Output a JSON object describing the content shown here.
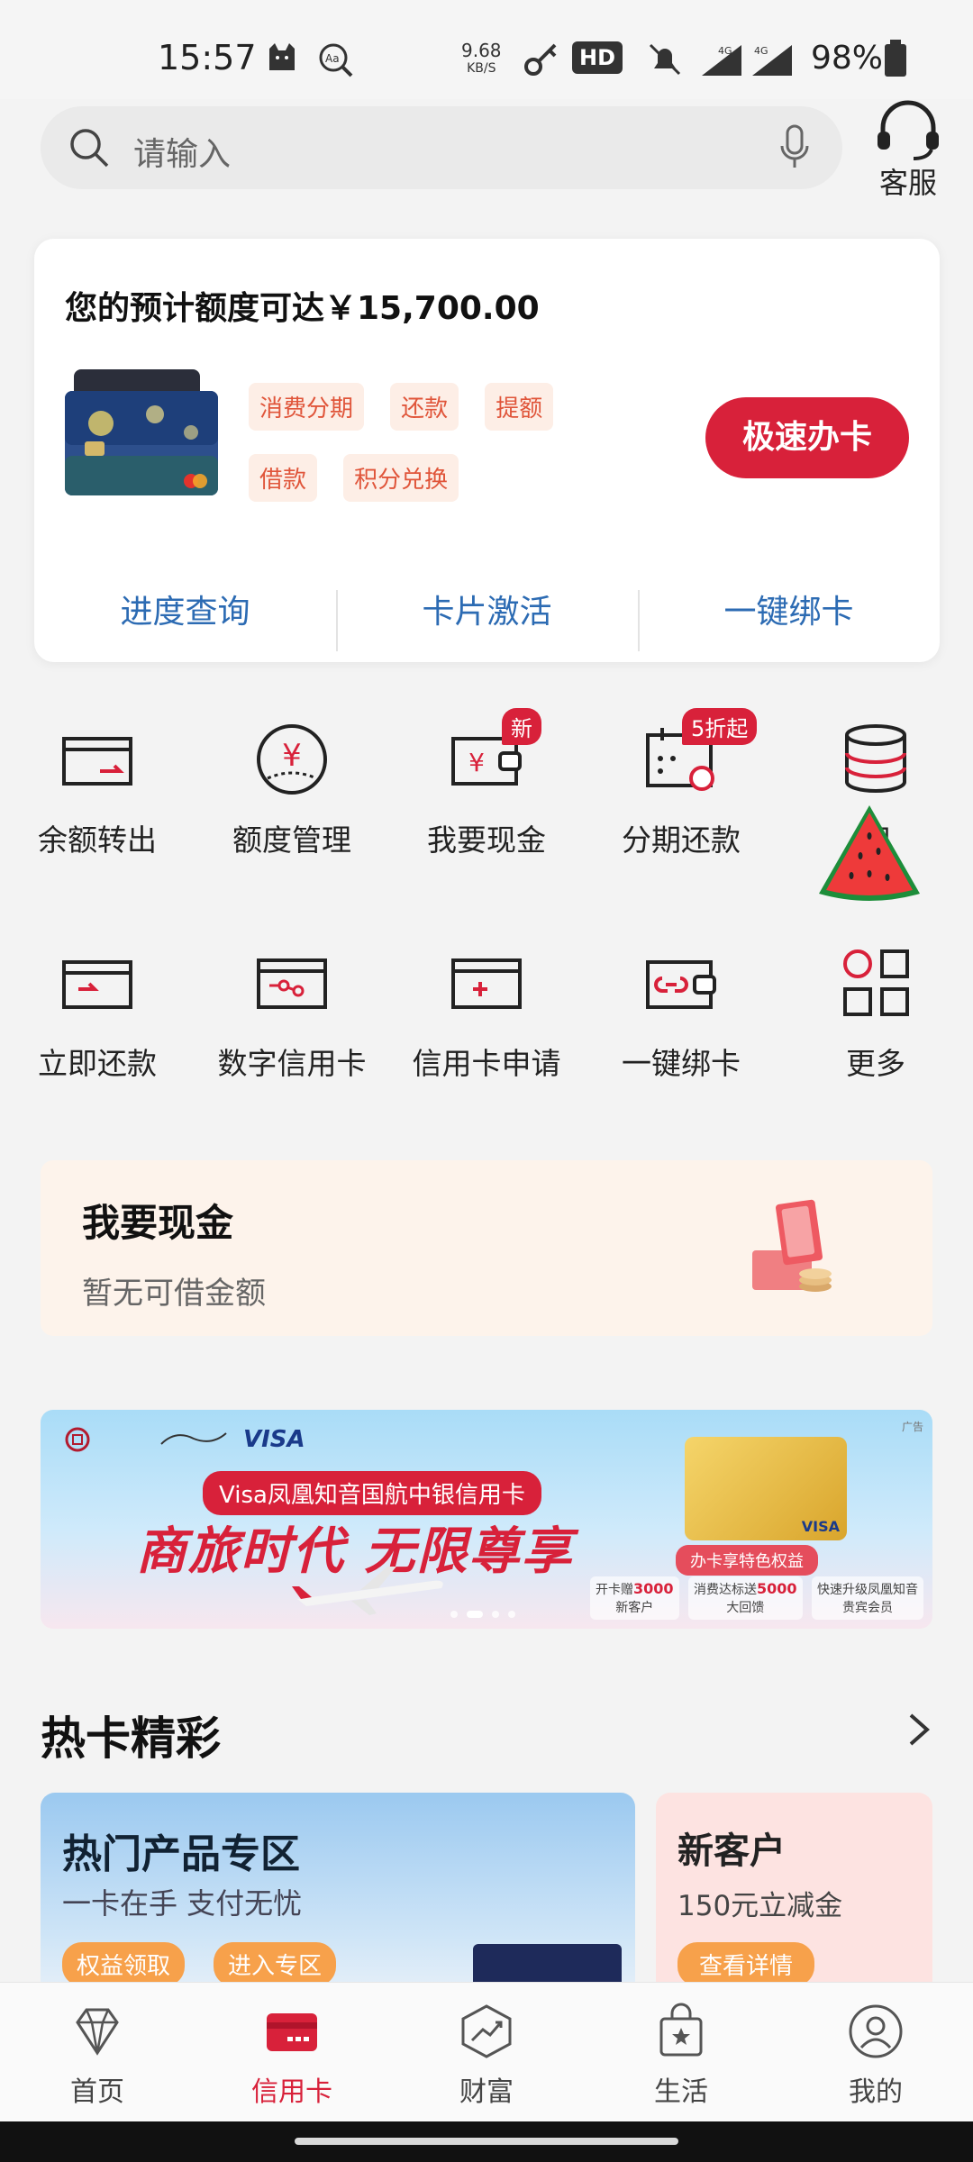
{
  "status": {
    "time": "15:57",
    "net_speed": "9.68",
    "net_unit": "KB/S",
    "hd_label": "HD",
    "battery": "98%"
  },
  "search": {
    "placeholder": "请输入",
    "service_label": "客服"
  },
  "credit_panel": {
    "headline": "您的预计额度可达￥15,700.00",
    "tags": [
      "消费分期",
      "还款",
      "提额",
      "借款",
      "积分兑换"
    ],
    "apply_button": "极速办卡",
    "quick_links": [
      "进度查询",
      "卡片激活",
      "一键绑卡"
    ]
  },
  "grid": {
    "row1": [
      {
        "label": "余额转出",
        "icon": "transfer-card-icon"
      },
      {
        "label": "额度管理",
        "icon": "yuan-circle-icon"
      },
      {
        "label": "我要现金",
        "icon": "wallet-yuan-icon",
        "badge": "新"
      },
      {
        "label": "分期还款",
        "icon": "calendar-icon",
        "badge": "5折起"
      },
      {
        "label": "积",
        "icon": "database-icon"
      }
    ],
    "row2": [
      {
        "label": "立即还款",
        "icon": "repay-card-icon"
      },
      {
        "label": "数字信用卡",
        "icon": "digital-card-icon"
      },
      {
        "label": "信用卡申请",
        "icon": "add-card-icon"
      },
      {
        "label": "一键绑卡",
        "icon": "link-card-icon"
      },
      {
        "label": "更多",
        "icon": "grid-more-icon"
      }
    ]
  },
  "cash": {
    "title": "我要现金",
    "subtitle": "暂无可借金额"
  },
  "ad": {
    "pill": "Visa凤凰知音国航中银信用卡",
    "slogan": "商旅时代  无限尊享",
    "visa": "VISA",
    "benefit": "办卡享特色权益",
    "box1_label": "开卡赠",
    "box1_value": "3000",
    "box1_sub": "新客户",
    "box2_label": "消费达标送",
    "box2_value": "5000",
    "box2_sub": "大回馈",
    "box3_label": "快速升级凤凰知音",
    "box3_sub": "贵宾会员",
    "corner": "广告"
  },
  "hot": {
    "title": "热卡精彩",
    "card1_title": "热门产品专区",
    "card1_sub": "一卡在手 支付无忧",
    "card1_chip1": "权益领取",
    "card1_chip2": "进入专区",
    "card2_title": "新客户",
    "card2_sub": "150元立减金",
    "card2_chip": "查看详情"
  },
  "tabs": [
    {
      "label": "首页",
      "active": false
    },
    {
      "label": "信用卡",
      "active": true
    },
    {
      "label": "财富",
      "active": false
    },
    {
      "label": "生活",
      "active": false
    },
    {
      "label": "我的",
      "active": false
    }
  ],
  "colors": {
    "accent": "#d8213a",
    "link": "#2c6bb3",
    "tag_bg": "#fdeee6",
    "tag_text": "#e0553a"
  }
}
